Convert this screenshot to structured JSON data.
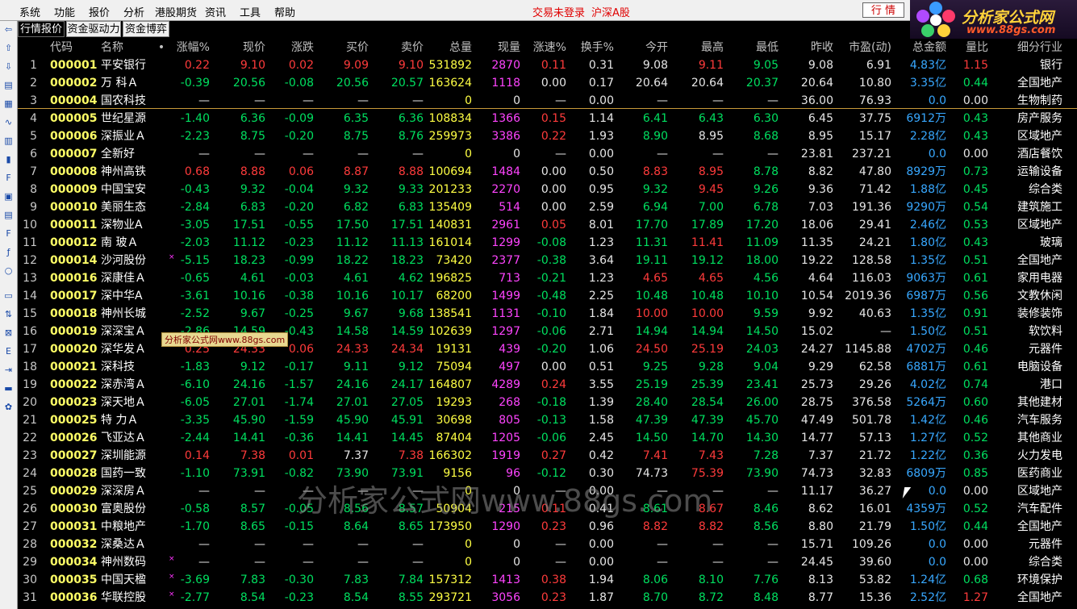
{
  "menu": {
    "items": [
      "系统",
      "功能",
      "报价",
      "分析",
      "港股期货",
      "资讯",
      "工具",
      "帮助"
    ],
    "status": "交易未登录",
    "market": "沪深A股",
    "trade_btn": "行  情"
  },
  "logo": {
    "main": "分析家公式网",
    "sub": "www.88gs.com"
  },
  "tabs": [
    "行情报价",
    "资金驱动力",
    "资金博弈"
  ],
  "columns": [
    "代码",
    "名称",
    "•",
    "涨幅%",
    "现价",
    "涨跌",
    "买价",
    "卖价",
    "总量",
    "现量",
    "涨速%",
    "换手%",
    "今开",
    "最高",
    "最低",
    "昨收",
    "市盈(动)",
    "总金额",
    "量比",
    "细分行业"
  ],
  "rows": [
    [
      "1",
      "000001",
      "平安银行",
      "",
      "0.22",
      "9.10",
      "0.02",
      "9.09",
      "9.10",
      "531892",
      "2870",
      "0.11",
      "0.31",
      "9.08",
      "9.11",
      "9.05",
      "9.08",
      "6.91",
      "4.83亿",
      "1.15",
      "银行"
    ],
    [
      "2",
      "000002",
      "万 科Ａ",
      "",
      "-0.39",
      "20.56",
      "-0.08",
      "20.56",
      "20.57",
      "163624",
      "1118",
      "0.00",
      "0.17",
      "20.64",
      "20.64",
      "20.37",
      "20.64",
      "10.80",
      "3.35亿",
      "0.44",
      "全国地产"
    ],
    [
      "3",
      "000004",
      "国农科技",
      "",
      "—",
      "—",
      "—",
      "—",
      "—",
      "0",
      "0",
      "—",
      "0.00",
      "—",
      "—",
      "—",
      "36.00",
      "76.93",
      "0.0",
      "0.00",
      "生物制药"
    ],
    [
      "4",
      "000005",
      "世纪星源",
      "",
      "-1.40",
      "6.36",
      "-0.09",
      "6.35",
      "6.36",
      "108834",
      "1366",
      "0.15",
      "1.14",
      "6.41",
      "6.43",
      "6.30",
      "6.45",
      "37.75",
      "6912万",
      "0.43",
      "房产服务"
    ],
    [
      "5",
      "000006",
      "深振业Ａ",
      "",
      "-2.23",
      "8.75",
      "-0.20",
      "8.75",
      "8.76",
      "259973",
      "3386",
      "0.22",
      "1.93",
      "8.90",
      "8.95",
      "8.68",
      "8.95",
      "15.17",
      "2.28亿",
      "0.43",
      "区域地产"
    ],
    [
      "6",
      "000007",
      "全新好",
      "",
      "—",
      "—",
      "—",
      "—",
      "—",
      "0",
      "0",
      "—",
      "0.00",
      "—",
      "—",
      "—",
      "23.81",
      "237.21",
      "0.0",
      "0.00",
      "酒店餐饮"
    ],
    [
      "7",
      "000008",
      "神州高铁",
      "",
      "0.68",
      "8.88",
      "0.06",
      "8.87",
      "8.88",
      "100694",
      "1484",
      "0.00",
      "0.50",
      "8.83",
      "8.95",
      "8.78",
      "8.82",
      "47.80",
      "8929万",
      "0.73",
      "运输设备"
    ],
    [
      "8",
      "000009",
      "中国宝安",
      "",
      "-0.43",
      "9.32",
      "-0.04",
      "9.32",
      "9.33",
      "201233",
      "2270",
      "0.00",
      "0.95",
      "9.32",
      "9.45",
      "9.26",
      "9.36",
      "71.42",
      "1.88亿",
      "0.45",
      "综合类"
    ],
    [
      "9",
      "000010",
      "美丽生态",
      "",
      "-2.84",
      "6.83",
      "-0.20",
      "6.82",
      "6.83",
      "135409",
      "514",
      "0.00",
      "2.59",
      "6.94",
      "7.00",
      "6.78",
      "7.03",
      "191.36",
      "9290万",
      "0.54",
      "建筑施工"
    ],
    [
      "10",
      "000011",
      "深物业A",
      "",
      "-3.05",
      "17.51",
      "-0.55",
      "17.50",
      "17.51",
      "140831",
      "2961",
      "0.05",
      "8.01",
      "17.70",
      "17.89",
      "17.20",
      "18.06",
      "29.41",
      "2.46亿",
      "0.53",
      "区域地产"
    ],
    [
      "11",
      "000012",
      "南 玻Ａ",
      "",
      "-2.03",
      "11.12",
      "-0.23",
      "11.12",
      "11.13",
      "161014",
      "1299",
      "-0.08",
      "1.23",
      "11.31",
      "11.41",
      "11.09",
      "11.35",
      "24.21",
      "1.80亿",
      "0.43",
      "玻璃"
    ],
    [
      "12",
      "000014",
      "沙河股份",
      "×",
      "-5.15",
      "18.23",
      "-0.99",
      "18.22",
      "18.23",
      "73420",
      "2377",
      "-0.38",
      "3.64",
      "19.11",
      "19.12",
      "18.00",
      "19.22",
      "128.58",
      "1.35亿",
      "0.51",
      "全国地产"
    ],
    [
      "13",
      "000016",
      "深康佳Ａ",
      "",
      "-0.65",
      "4.61",
      "-0.03",
      "4.61",
      "4.62",
      "196825",
      "713",
      "-0.21",
      "1.23",
      "4.65",
      "4.65",
      "4.56",
      "4.64",
      "116.03",
      "9063万",
      "0.61",
      "家用电器"
    ],
    [
      "14",
      "000017",
      "深中华A",
      "",
      "-3.61",
      "10.16",
      "-0.38",
      "10.16",
      "10.17",
      "68200",
      "1499",
      "-0.48",
      "2.25",
      "10.48",
      "10.48",
      "10.10",
      "10.54",
      "2019.36",
      "6987万",
      "0.56",
      "文教休闲"
    ],
    [
      "15",
      "000018",
      "神州长城",
      "",
      "-2.52",
      "9.67",
      "-0.25",
      "9.67",
      "9.68",
      "138541",
      "1131",
      "-0.10",
      "1.84",
      "10.00",
      "10.00",
      "9.59",
      "9.92",
      "40.63",
      "1.35亿",
      "0.91",
      "装修装饰"
    ],
    [
      "16",
      "000019",
      "深深宝Ａ",
      "",
      "-2.86",
      "14.59",
      "-0.43",
      "14.58",
      "14.59",
      "102639",
      "1297",
      "-0.06",
      "2.71",
      "14.94",
      "14.94",
      "14.50",
      "15.02",
      "—",
      "1.50亿",
      "0.51",
      "软饮料"
    ],
    [
      "17",
      "000020",
      "深华发Ａ",
      "",
      "0.25",
      "24.33",
      "0.06",
      "24.33",
      "24.34",
      "19131",
      "439",
      "-0.20",
      "1.06",
      "24.50",
      "25.19",
      "24.03",
      "24.27",
      "1145.88",
      "4702万",
      "0.46",
      "元器件"
    ],
    [
      "18",
      "000021",
      "深科技",
      "",
      "-1.83",
      "9.12",
      "-0.17",
      "9.11",
      "9.12",
      "75094",
      "497",
      "0.00",
      "0.51",
      "9.25",
      "9.28",
      "9.04",
      "9.29",
      "62.58",
      "6881万",
      "0.61",
      "电脑设备"
    ],
    [
      "19",
      "000022",
      "深赤湾Ａ",
      "",
      "-6.10",
      "24.16",
      "-1.57",
      "24.16",
      "24.17",
      "164807",
      "4289",
      "0.24",
      "3.55",
      "25.19",
      "25.39",
      "23.41",
      "25.73",
      "29.26",
      "4.02亿",
      "0.74",
      "港口"
    ],
    [
      "20",
      "000023",
      "深天地Ａ",
      "",
      "-6.05",
      "27.01",
      "-1.74",
      "27.01",
      "27.05",
      "19293",
      "268",
      "-0.18",
      "1.39",
      "28.40",
      "28.54",
      "26.00",
      "28.75",
      "376.58",
      "5264万",
      "0.60",
      "其他建材"
    ],
    [
      "21",
      "000025",
      "特 力Ａ",
      "",
      "-3.35",
      "45.90",
      "-1.59",
      "45.90",
      "45.91",
      "30698",
      "805",
      "-0.13",
      "1.58",
      "47.39",
      "47.39",
      "45.70",
      "47.49",
      "501.78",
      "1.42亿",
      "0.46",
      "汽车服务"
    ],
    [
      "22",
      "000026",
      "飞亚达Ａ",
      "",
      "-2.44",
      "14.41",
      "-0.36",
      "14.41",
      "14.45",
      "87404",
      "1205",
      "-0.06",
      "2.45",
      "14.50",
      "14.70",
      "14.30",
      "14.77",
      "57.13",
      "1.27亿",
      "0.52",
      "其他商业"
    ],
    [
      "23",
      "000027",
      "深圳能源",
      "",
      "0.14",
      "7.38",
      "0.01",
      "7.37",
      "7.38",
      "166302",
      "1919",
      "0.27",
      "0.42",
      "7.41",
      "7.43",
      "7.28",
      "7.37",
      "21.72",
      "1.22亿",
      "0.36",
      "火力发电"
    ],
    [
      "24",
      "000028",
      "国药一致",
      "",
      "-1.10",
      "73.91",
      "-0.82",
      "73.90",
      "73.91",
      "9156",
      "96",
      "-0.12",
      "0.30",
      "74.73",
      "75.39",
      "73.90",
      "74.73",
      "32.83",
      "6809万",
      "0.85",
      "医药商业"
    ],
    [
      "25",
      "000029",
      "深深房Ａ",
      "",
      "—",
      "—",
      "—",
      "—",
      "—",
      "0",
      "0",
      "—",
      "0.00",
      "—",
      "—",
      "—",
      "11.17",
      "36.27",
      "0.0",
      "0.00",
      "区域地产"
    ],
    [
      "26",
      "000030",
      "富奥股份",
      "",
      "-0.58",
      "8.57",
      "-0.05",
      "8.56",
      "8.57",
      "50904",
      "215",
      "0.11",
      "0.41",
      "8.61",
      "8.67",
      "8.46",
      "8.62",
      "16.01",
      "4359万",
      "0.52",
      "汽车配件"
    ],
    [
      "27",
      "000031",
      "中粮地产",
      "",
      "-1.70",
      "8.65",
      "-0.15",
      "8.64",
      "8.65",
      "173950",
      "1290",
      "0.23",
      "0.96",
      "8.82",
      "8.82",
      "8.56",
      "8.80",
      "21.79",
      "1.50亿",
      "0.44",
      "全国地产"
    ],
    [
      "28",
      "000032",
      "深桑达Ａ",
      "",
      "—",
      "—",
      "—",
      "—",
      "—",
      "0",
      "0",
      "—",
      "0.00",
      "—",
      "—",
      "—",
      "15.71",
      "109.26",
      "0.0",
      "0.00",
      "元器件"
    ],
    [
      "29",
      "000034",
      "神州数码",
      "×",
      "—",
      "—",
      "—",
      "—",
      "—",
      "0",
      "0",
      "—",
      "0.00",
      "—",
      "—",
      "—",
      "24.45",
      "39.60",
      "0.0",
      "0.00",
      "综合类"
    ],
    [
      "30",
      "000035",
      "中国天楹",
      "×",
      "-3.69",
      "7.83",
      "-0.30",
      "7.83",
      "7.84",
      "157312",
      "1413",
      "0.38",
      "1.94",
      "8.06",
      "8.10",
      "7.76",
      "8.13",
      "53.82",
      "1.24亿",
      "0.68",
      "环境保护"
    ],
    [
      "31",
      "000036",
      "华联控股",
      "×",
      "-2.77",
      "8.54",
      "-0.23",
      "8.54",
      "8.55",
      "293721",
      "3056",
      "0.23",
      "1.87",
      "8.70",
      "8.72",
      "8.48",
      "8.77",
      "15.36",
      "2.52亿",
      "1.27",
      "全国地产"
    ]
  ],
  "watermark": {
    "big": "分析家公式网www.88gs.com",
    "small": "分析家公式网www.88gs.com"
  },
  "colors": {
    "up": "#ff3b3b",
    "down": "#00e060",
    "code": "#ffff66",
    "volume": "#ffff44",
    "cur_volume": "#ff44ff",
    "amount": "#38a8ff",
    "background": "#000000"
  }
}
